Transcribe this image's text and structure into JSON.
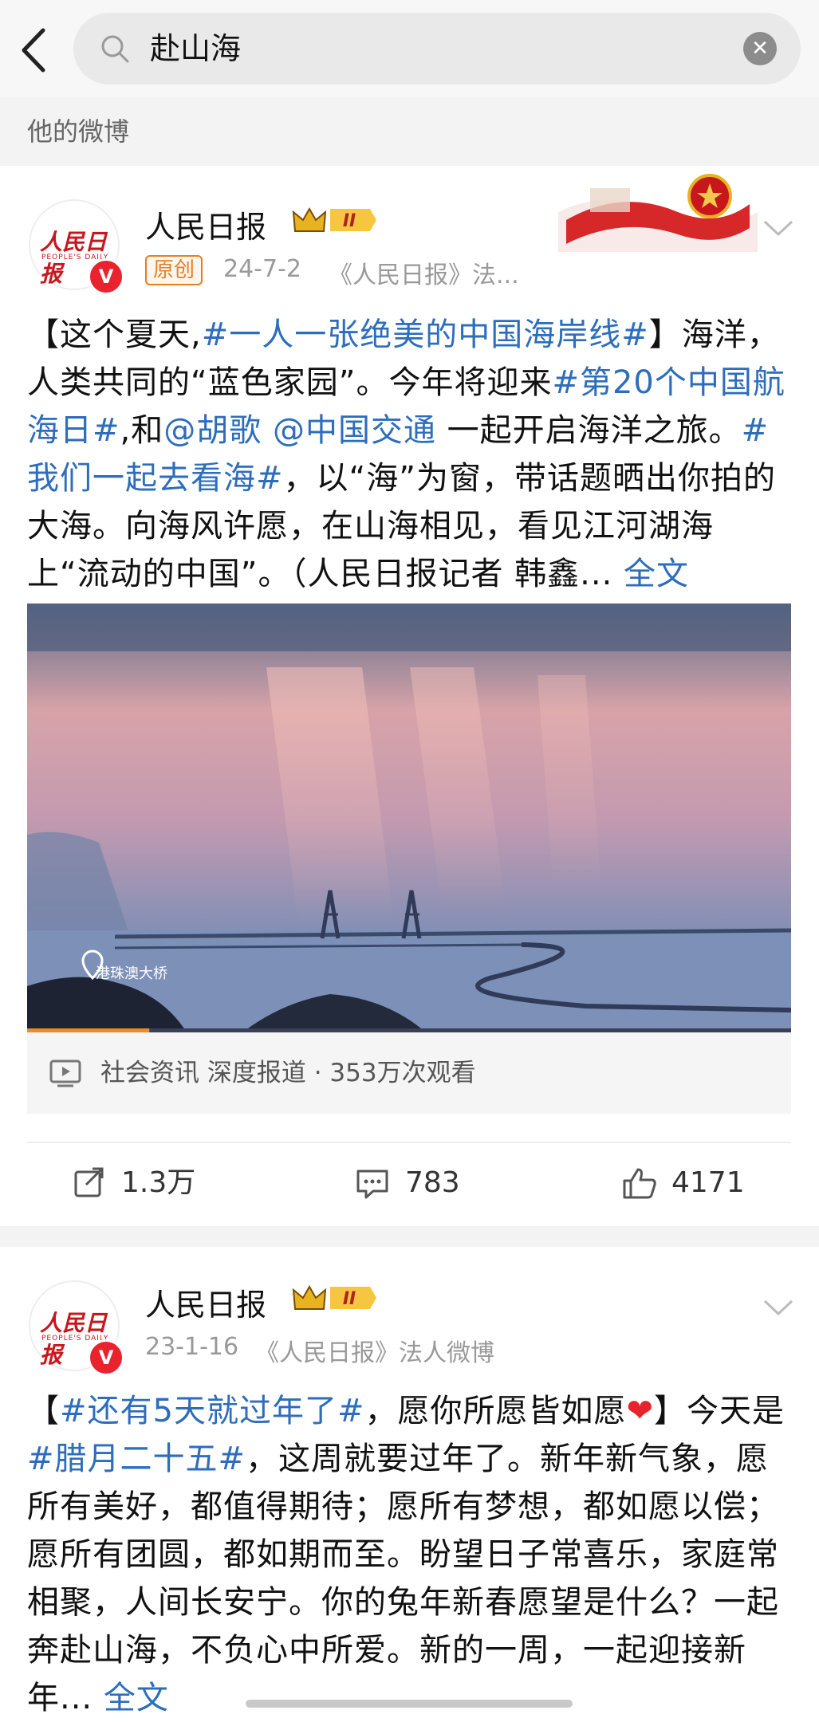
{
  "search": {
    "query": "赴山海",
    "clear_glyph": "✕"
  },
  "section_title": "他的微博",
  "posts": [
    {
      "author": "人民日报",
      "rank_badge": "II",
      "avatar_logo": "人民日报",
      "avatar_sub": "PEOPLE'S DAILY",
      "verified_glyph": "V",
      "original_tag": "原创",
      "date": "24-7-2",
      "source": "《人民日报》法...",
      "text": {
        "p1": "【这个夏天,",
        "t1": "#一人一张绝美的中国海岸线#",
        "p2": "】海洋，人类共同的“蓝色家园”。今年将迎来",
        "t2": "#第20个中国航海日#",
        "p3": ",和",
        "m1": "@胡歌",
        "p4": " ",
        "m2": "@中国交通",
        "p5": " 一起开启海洋之旅。",
        "t3": "#我们一起去看海#",
        "p6": "，以“海”为窗，带话题晒出你拍的大海。向海风许愿，在山海相见，看见江河湖海上“流动的中国”。（人民日报记者 韩鑫...",
        "more": " 全文"
      },
      "video_location": "港珠澳大桥",
      "video_progress": 0.16,
      "video_info": "社会资讯 深度报道 · 353万次观看",
      "reposts": "1.3万",
      "comments": "783",
      "likes": "4171"
    },
    {
      "author": "人民日报",
      "rank_badge": "II",
      "avatar_logo": "人民日报",
      "avatar_sub": "PEOPLE'S DAILY",
      "verified_glyph": "V",
      "date": "23-1-16",
      "source": "《人民日报》法人微博",
      "text": {
        "p1": "【",
        "t1": "#还有5天就过年了#",
        "p2": "，愿你所愿皆如愿",
        "heart": "❤",
        "p3": "】今天是",
        "t2": "#腊月二十五#",
        "p4": "，这周就要过年了。新年新气象，愿所有美好，都值得期待；愿所有梦想，都如愿以偿；愿所有团圆，都如期而至。盼望日子常喜乐，家庭常相聚，人间长安宁。你的兔年新春愿望是什么？一起奔赴山海，不负心中所爱。新的一周，一起迎接新年...",
        "more": " 全文"
      }
    }
  ],
  "colors": {
    "link": "#2d6dbc",
    "verified": "#e8232d",
    "original_tag": "#e67e22"
  }
}
